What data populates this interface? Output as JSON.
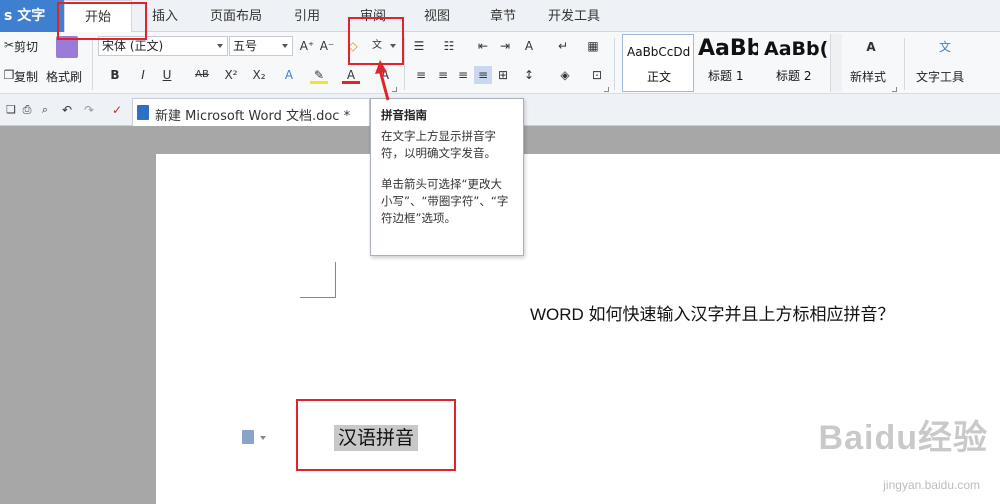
{
  "app": {
    "name": "s 文字"
  },
  "tabs": [
    "开始",
    "插入",
    "页面布局",
    "引用",
    "审阅",
    "视图",
    "章节",
    "开发工具"
  ],
  "ribbon": {
    "cut": "剪切",
    "copy": "复制",
    "format_painter": "格式刷",
    "font_name": "宋体 (正文)",
    "font_size": "五号",
    "styles": [
      {
        "sample": "AaBbCcDd",
        "name": "正文"
      },
      {
        "sample": "AaBb",
        "name": "标题 1"
      },
      {
        "sample": "AaBb(",
        "name": "标题 2"
      }
    ],
    "new_style": "新样式",
    "text_tools": "文字工具"
  },
  "document_tab": {
    "title": "新建 Microsoft Word 文档.doc *",
    "close": "×"
  },
  "tooltip": {
    "title": "拼音指南",
    "line1": "在文字上方显示拼音字符，以明确文字发音。",
    "line2": "单击箭头可选择“更改大小写”、“带圈字符”、“字符边框”选项。"
  },
  "document": {
    "heading": "WORD 如何快速输入汉字并且上方标相应拼音？",
    "selected_text": "汉语拼音"
  },
  "watermark": {
    "main": "Baidu经验",
    "sub": "jingyan.baidu.com"
  },
  "colors": {
    "accent": "#3f7fcf",
    "annotation": "#e0242b"
  }
}
